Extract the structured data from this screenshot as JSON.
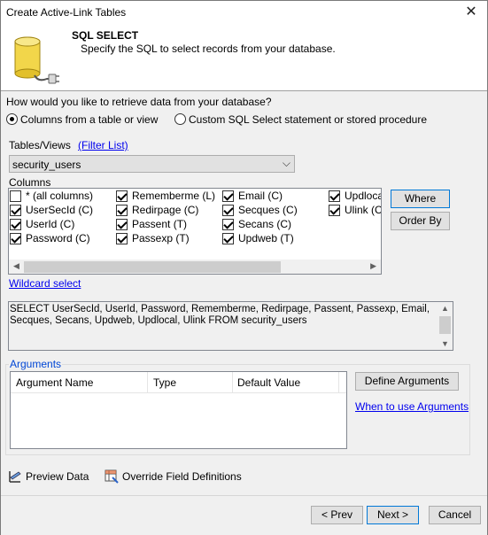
{
  "window": {
    "title": "Create Active-Link Tables",
    "close_glyph": "✕"
  },
  "header": {
    "title": "SQL SELECT",
    "subtitle": "Specify the SQL to select records from your database."
  },
  "question": "How would you like to retrieve data from your database?",
  "retrieve_options": [
    {
      "label": "Columns from a table or view",
      "checked": true
    },
    {
      "label": "Custom SQL Select statement or stored procedure",
      "checked": false
    }
  ],
  "tables": {
    "label": "Tables/Views",
    "filter_link": "(Filter List)",
    "selected": "security_users",
    "arrow": "⌵"
  },
  "columns": {
    "label": "Columns",
    "items": [
      [
        {
          "label": "* (all columns)",
          "checked": false
        },
        {
          "label": "Rememberme (L)",
          "checked": true
        },
        {
          "label": "Email (C)",
          "checked": true
        },
        {
          "label": "Updloca",
          "checked": true
        }
      ],
      [
        {
          "label": "UserSecId (C)",
          "checked": true
        },
        {
          "label": "Redirpage (C)",
          "checked": true
        },
        {
          "label": "Secques (C)",
          "checked": true
        },
        {
          "label": "Ulink (C",
          "checked": true
        }
      ],
      [
        {
          "label": "UserId (C)",
          "checked": true
        },
        {
          "label": "Passent (T)",
          "checked": true
        },
        {
          "label": "Secans (C)",
          "checked": true
        }
      ],
      [
        {
          "label": "Password (C)",
          "checked": true
        },
        {
          "label": "Passexp (T)",
          "checked": true
        },
        {
          "label": "Updweb (T)",
          "checked": true
        }
      ]
    ]
  },
  "where_button": "Where",
  "order_by_button": "Order By",
  "wildcard_link": "Wildcard select",
  "sql": "SELECT UserSecId, UserId, Password, Rememberme, Redirpage, Passent, Passexp, Email, Secques, Secans, Updweb, Updlocal, Ulink FROM security_users",
  "arguments": {
    "label": "Arguments",
    "columns": [
      "Argument Name",
      "Type",
      "Default Value"
    ],
    "define_button": "Define Arguments",
    "help_link": "When to use Arguments"
  },
  "preview_data": "Preview Data",
  "override_fields": "Override Field Definitions",
  "footer": {
    "prev": "< Prev",
    "next": "Next >",
    "cancel": "Cancel"
  }
}
